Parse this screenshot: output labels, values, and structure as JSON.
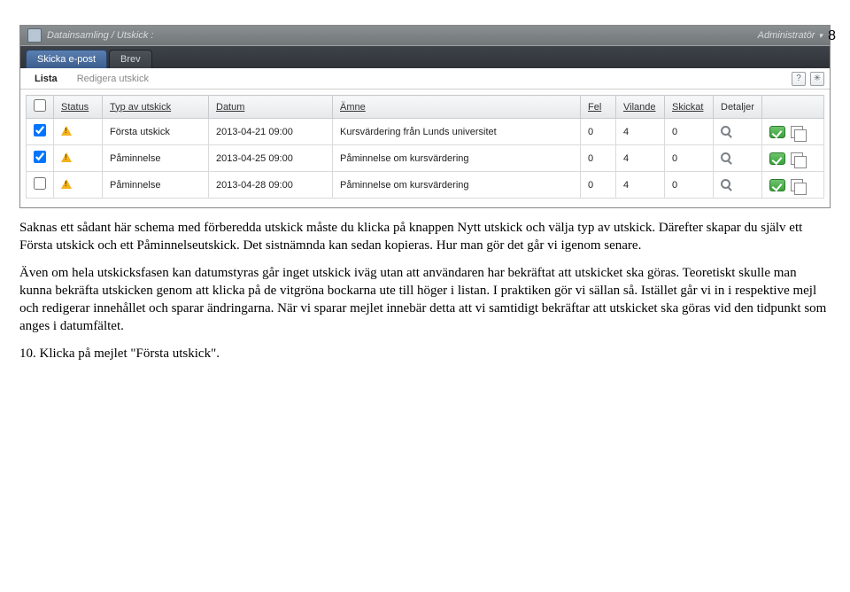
{
  "page_number": "8",
  "topbar": {
    "breadcrumb": "Datainsamling / Utskick :",
    "user_role": "Administratör"
  },
  "tabs": {
    "email": "Skicka e-post",
    "letter": "Brev"
  },
  "subtabs": {
    "list": "Lista",
    "edit": "Redigera utskick"
  },
  "columns": {
    "checkbox": "",
    "status": "Status",
    "type": "Typ av utskick",
    "date": "Datum",
    "subject": "Ämne",
    "errors": "Fel",
    "pending": "Vilande",
    "sent": "Skickat",
    "details": "Detaljer"
  },
  "rows": [
    {
      "checked": true,
      "type": "Första utskick",
      "date": "2013-04-21 09:00",
      "subject": "Kursvärdering från Lunds universitet",
      "errors": "0",
      "pending": "4",
      "sent": "0"
    },
    {
      "checked": true,
      "type": "Påminnelse",
      "date": "2013-04-25 09:00",
      "subject": "Påminnelse om kursvärdering",
      "errors": "0",
      "pending": "4",
      "sent": "0"
    },
    {
      "checked": false,
      "type": "Påminnelse",
      "date": "2013-04-28 09:00",
      "subject": "Påminnelse om kursvärdering",
      "errors": "0",
      "pending": "4",
      "sent": "0"
    }
  ],
  "body": {
    "p1": "Saknas ett sådant här schema med förberedda utskick måste du klicka på knappen Nytt utskick och välja typ av utskick. Därefter skapar du själv ett Första utskick och ett Påminnelseutskick. Det sistnämnda kan sedan kopieras. Hur man gör det går vi igenom senare.",
    "p2": "Även om hela utskicksfasen kan datumstyras går inget utskick iväg utan att användaren har bekräftat att utskicket ska göras. Teoretiskt skulle man kunna bekräfta utskicken genom att klicka på de vitgröna bockarna ute till höger i listan. I praktiken gör vi sällan så. Istället går vi in i respektive mejl och redigerar innehållet och sparar ändringarna. När vi sparar mejlet innebär detta att vi samtidigt bekräftar att utskicket ska göras vid den tidpunkt som anges i datumfältet.",
    "p3": "10. Klicka på mejlet \"Första utskick\"."
  }
}
